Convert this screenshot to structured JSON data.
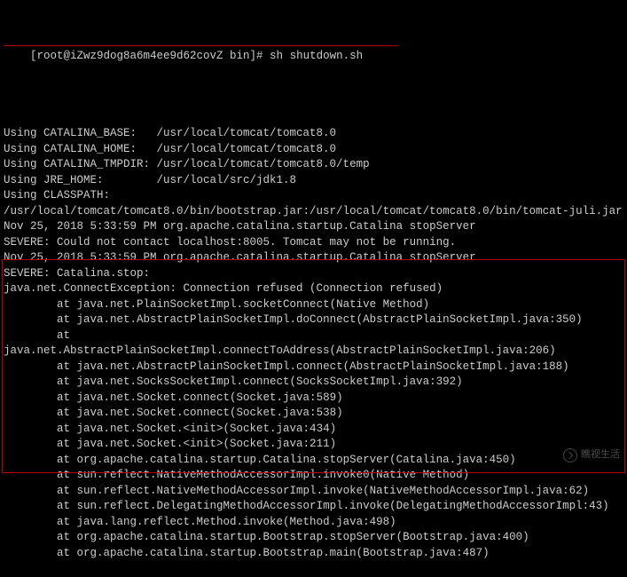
{
  "terminal": {
    "prompt": "[root@iZwz9dog8a6m4ee9d62covZ bin]# sh shutdown.sh",
    "lines": [
      "Using CATALINA_BASE:   /usr/local/tomcat/tomcat8.0",
      "Using CATALINA_HOME:   /usr/local/tomcat/tomcat8.0",
      "Using CATALINA_TMPDIR: /usr/local/tomcat/tomcat8.0/temp",
      "Using JRE_HOME:        /usr/local/src/jdk1.8",
      "Using CLASSPATH:       /usr/local/tomcat/tomcat8.0/bin/bootstrap.jar:/usr/local/tomcat/tomcat8.0/bin/tomcat-juli.jar",
      "Nov 25, 2018 5:33:59 PM org.apache.catalina.startup.Catalina stopServer",
      "SEVERE: Could not contact localhost:8005. Tomcat may not be running.",
      "Nov 25, 2018 5:33:59 PM org.apache.catalina.startup.Catalina stopServer",
      "SEVERE: Catalina.stop:",
      "java.net.ConnectException: Connection refused (Connection refused)",
      "        at java.net.PlainSocketImpl.socketConnect(Native Method)",
      "        at java.net.AbstractPlainSocketImpl.doConnect(AbstractPlainSocketImpl.java:350)",
      "        at java.net.AbstractPlainSocketImpl.connectToAddress(AbstractPlainSocketImpl.java:206)",
      "        at java.net.AbstractPlainSocketImpl.connect(AbstractPlainSocketImpl.java:188)",
      "        at java.net.SocksSocketImpl.connect(SocksSocketImpl.java:392)",
      "        at java.net.Socket.connect(Socket.java:589)",
      "        at java.net.Socket.connect(Socket.java:538)",
      "        at java.net.Socket.<init>(Socket.java:434)",
      "        at java.net.Socket.<init>(Socket.java:211)",
      "        at org.apache.catalina.startup.Catalina.stopServer(Catalina.java:450)",
      "        at sun.reflect.NativeMethodAccessorImpl.invoke0(Native Method)",
      "        at sun.reflect.NativeMethodAccessorImpl.invoke(NativeMethodAccessorImpl.java:62)",
      "        at sun.reflect.DelegatingMethodAccessorImpl.invoke(DelegatingMethodAccessorImpl:43)",
      "        at java.lang.reflect.Method.invoke(Method.java:498)",
      "        at org.apache.catalina.startup.Bootstrap.stopServer(Bootstrap.java:400)",
      "        at org.apache.catalina.startup.Bootstrap.main(Bootstrap.java:487)"
    ]
  },
  "watermark": {
    "text": "瞧视生活"
  }
}
